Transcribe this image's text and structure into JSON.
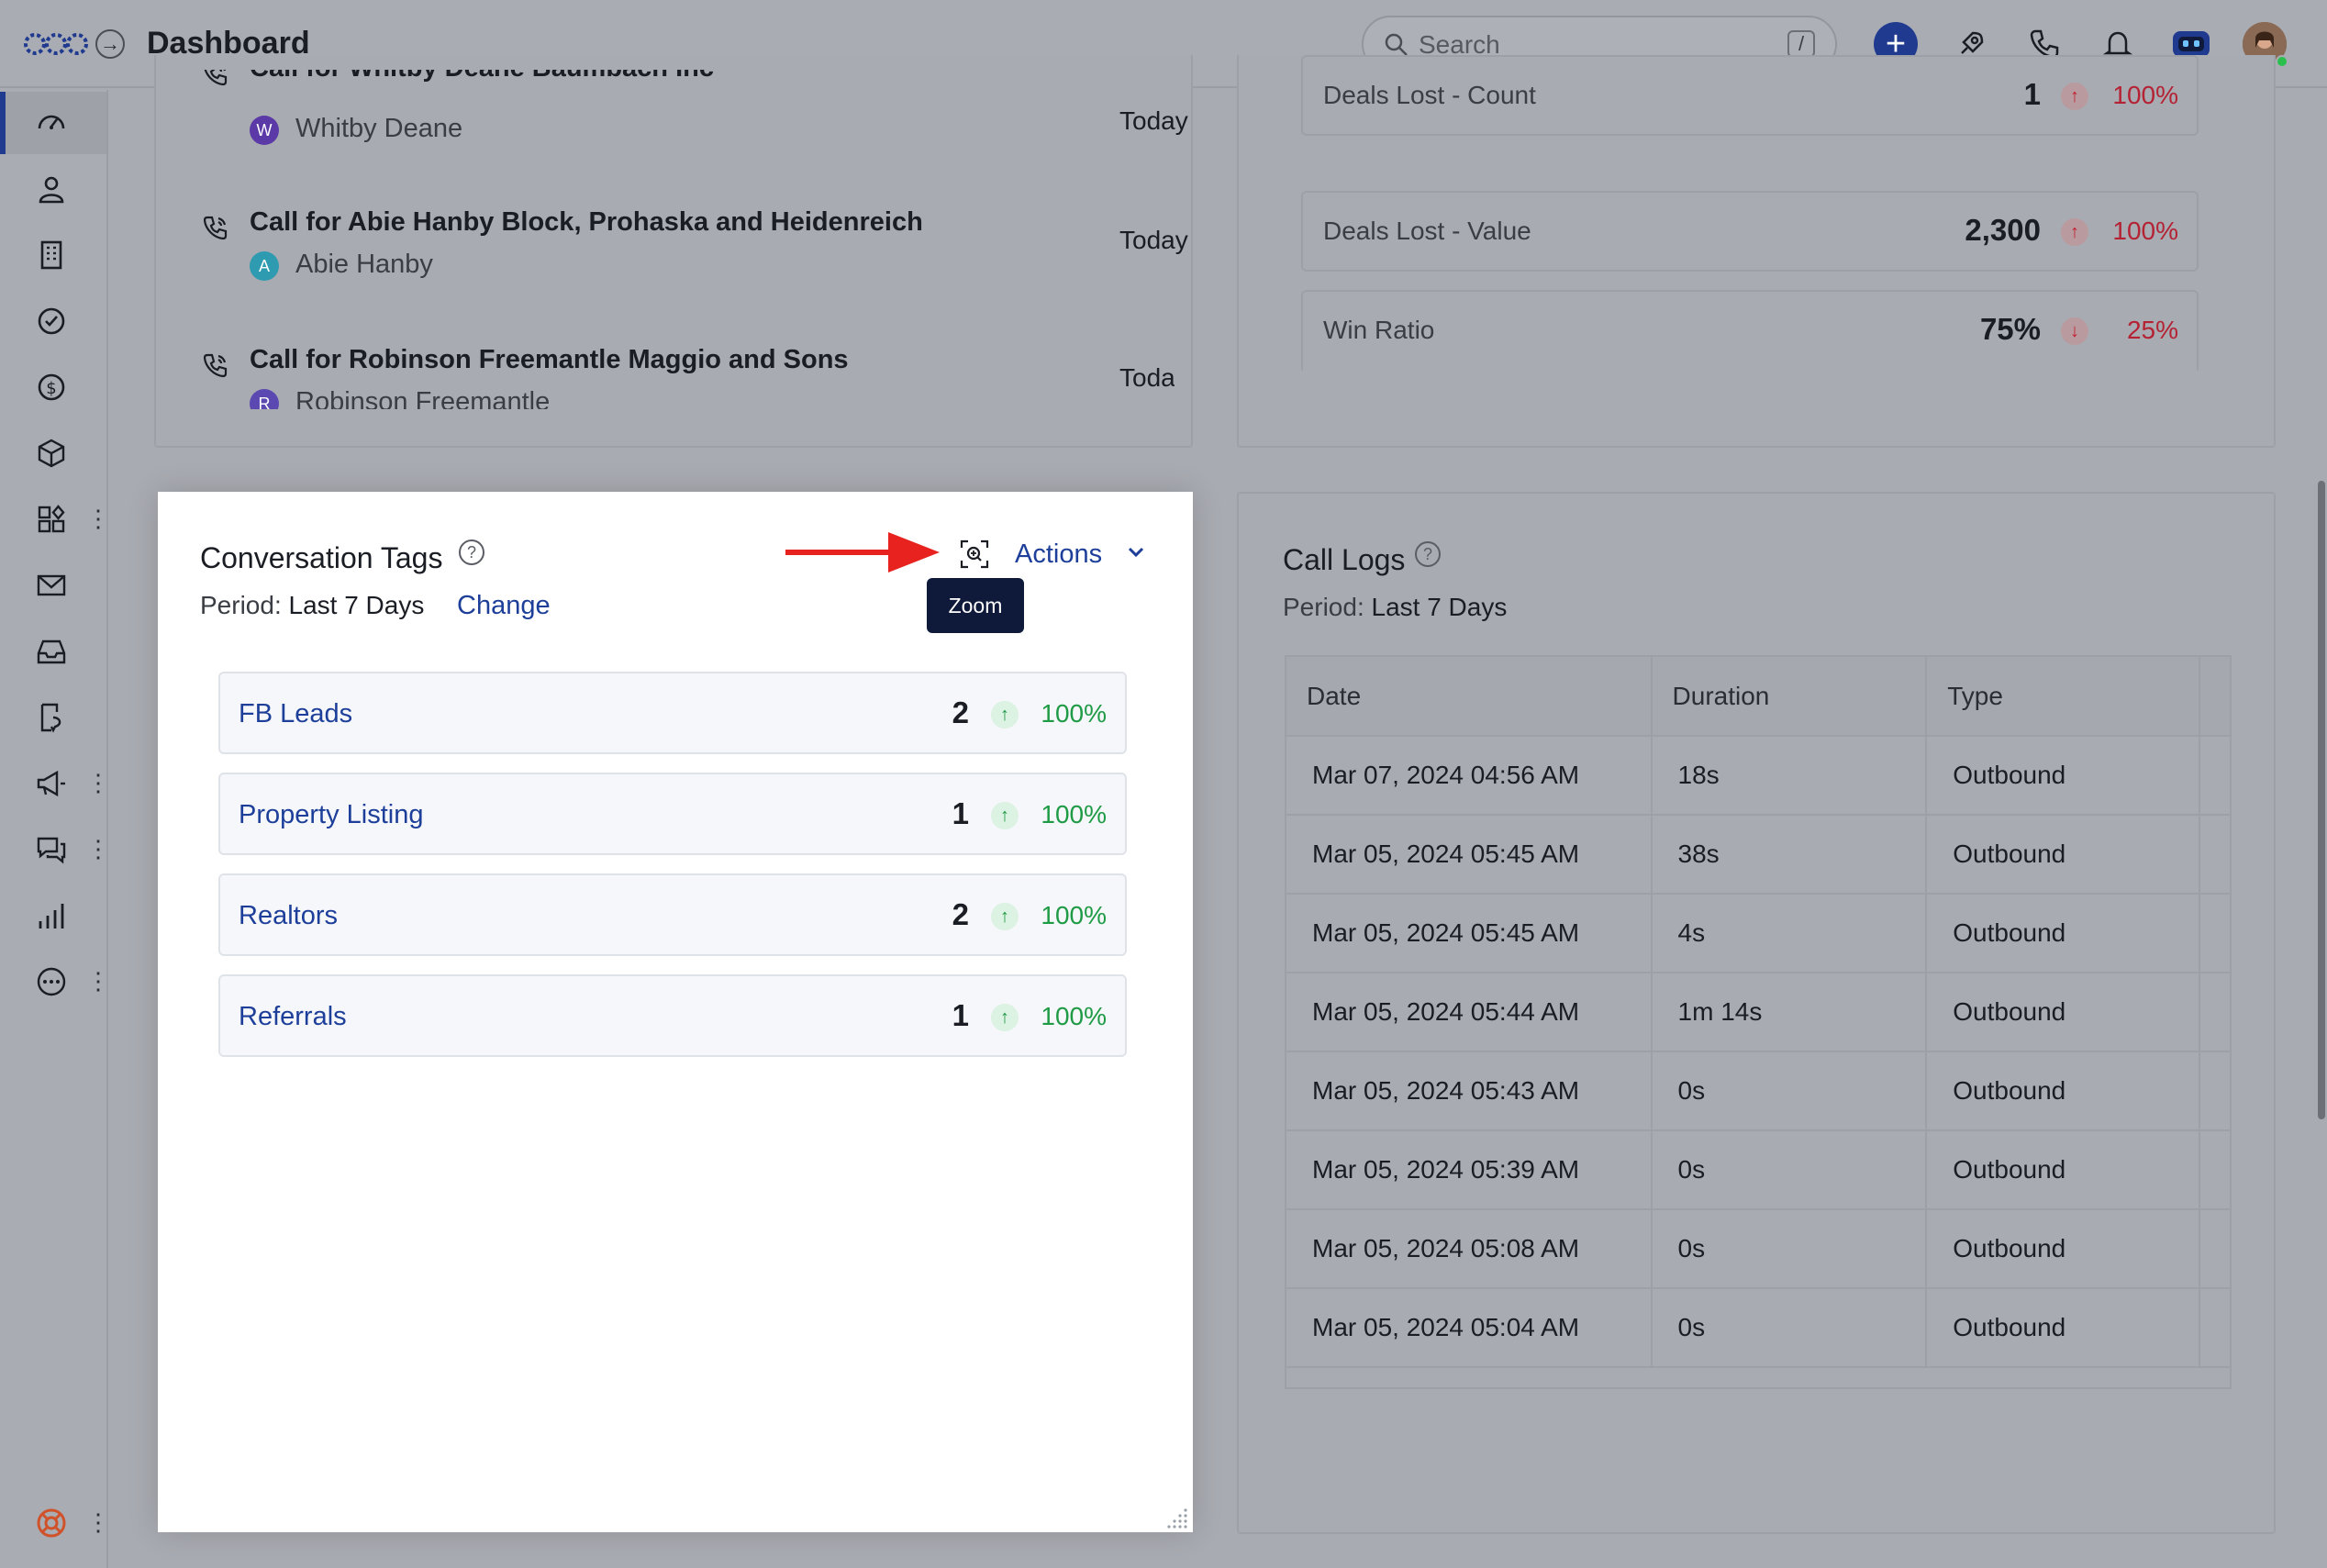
{
  "header": {
    "title": "Dashboard",
    "search_placeholder": "Search",
    "search_shortcut": "/"
  },
  "tasks": [
    {
      "title": "Call for Whitby Deane Baumbach Inc",
      "person": "Whitby Deane",
      "initial": "W",
      "avatar_color": "#5b3aa8",
      "when": "Today"
    },
    {
      "title": "Call for Abie Hanby Block, Prohaska and Heidenreich",
      "person": "Abie Hanby",
      "initial": "A",
      "avatar_color": "#2e9bb0",
      "when": "Today"
    },
    {
      "title": "Call for Robinson Freemantle Maggio and Sons",
      "person": "Robinson Freemantle",
      "initial": "R",
      "avatar_color": "#5b48b0",
      "when": "Today"
    }
  ],
  "stats": [
    {
      "label": "Deals Lost - Count",
      "value": "1",
      "change": "100%",
      "direction": "up"
    },
    {
      "label": "Deals Lost - Value",
      "value": "2,300",
      "change": "100%",
      "direction": "up"
    },
    {
      "label": "Win Ratio",
      "value": "75%",
      "change": "25%",
      "direction": "down"
    }
  ],
  "conversation_tags": {
    "title": "Conversation Tags",
    "period_prefix": "Period:",
    "period_value": "Last 7 Days",
    "change_label": "Change",
    "actions_label": "Actions",
    "tooltip": "Zoom",
    "rows": [
      {
        "name": "FB Leads",
        "count": "2",
        "change": "100%"
      },
      {
        "name": "Property Listing",
        "count": "1",
        "change": "100%"
      },
      {
        "name": "Realtors",
        "count": "2",
        "change": "100%"
      },
      {
        "name": "Referrals",
        "count": "1",
        "change": "100%"
      }
    ]
  },
  "call_logs": {
    "title": "Call Logs",
    "period_prefix": "Period:",
    "period_value": "Last 7 Days",
    "columns": [
      "Date",
      "Duration",
      "Type"
    ],
    "rows": [
      {
        "date": "Mar 07, 2024 04:56 AM",
        "duration": "18s",
        "type": "Outbound"
      },
      {
        "date": "Mar 05, 2024 05:45 AM",
        "duration": "38s",
        "type": "Outbound"
      },
      {
        "date": "Mar 05, 2024 05:45 AM",
        "duration": "4s",
        "type": "Outbound"
      },
      {
        "date": "Mar 05, 2024 05:44 AM",
        "duration": "1m 14s",
        "type": "Outbound"
      },
      {
        "date": "Mar 05, 2024 05:43 AM",
        "duration": "0s",
        "type": "Outbound"
      },
      {
        "date": "Mar 05, 2024 05:39 AM",
        "duration": "0s",
        "type": "Outbound"
      },
      {
        "date": "Mar 05, 2024 05:08 AM",
        "duration": "0s",
        "type": "Outbound"
      },
      {
        "date": "Mar 05, 2024 05:04 AM",
        "duration": "0s",
        "type": "Outbound"
      }
    ]
  },
  "colors": {
    "accent": "#1d3f9a",
    "positive": "#1f9a45",
    "negative": "#b42233",
    "tooltip_bg": "#0f1a3a",
    "annotation_arrow": "#e8231f"
  },
  "sidebar_icons": [
    "dashboard-icon",
    "contacts-icon",
    "companies-icon",
    "tasks-icon",
    "deals-icon",
    "products-icon",
    "apps-icon",
    "email-icon",
    "inbox-icon",
    "workflow-icon",
    "campaigns-icon",
    "conversations-icon",
    "reports-icon",
    "more-icon",
    "help-icon"
  ]
}
